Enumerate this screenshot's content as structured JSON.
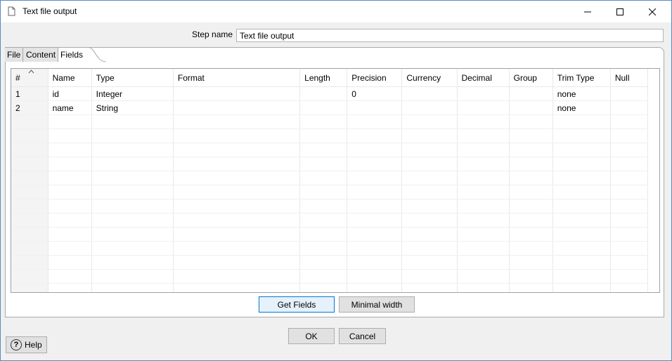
{
  "window": {
    "title": "Text file output"
  },
  "step_name": {
    "label": "Step name",
    "value": "Text file output"
  },
  "tabs": [
    {
      "label": "File"
    },
    {
      "label": "Content"
    },
    {
      "label": "Fields",
      "active": true
    }
  ],
  "grid": {
    "columns": [
      "#",
      "Name",
      "Type",
      "Format",
      "Length",
      "Precision",
      "Currency",
      "Decimal",
      "Group",
      "Trim Type",
      "Null"
    ],
    "rows": [
      [
        "1",
        "id",
        "Integer",
        "",
        "",
        "0",
        "",
        "",
        "",
        "none",
        ""
      ],
      [
        "2",
        "name",
        "String",
        "",
        "",
        "",
        "",
        "",
        "",
        "none",
        ""
      ]
    ]
  },
  "buttons": {
    "get_fields": "Get Fields",
    "minimal_width": "Minimal width",
    "ok": "OK",
    "cancel": "Cancel",
    "help": "Help"
  },
  "icons": {
    "app": "document-icon",
    "minimize": "minimize-icon",
    "maximize": "maximize-icon",
    "close": "close-icon",
    "help": "question-circle-icon",
    "sort": "sort-caret-icon"
  }
}
